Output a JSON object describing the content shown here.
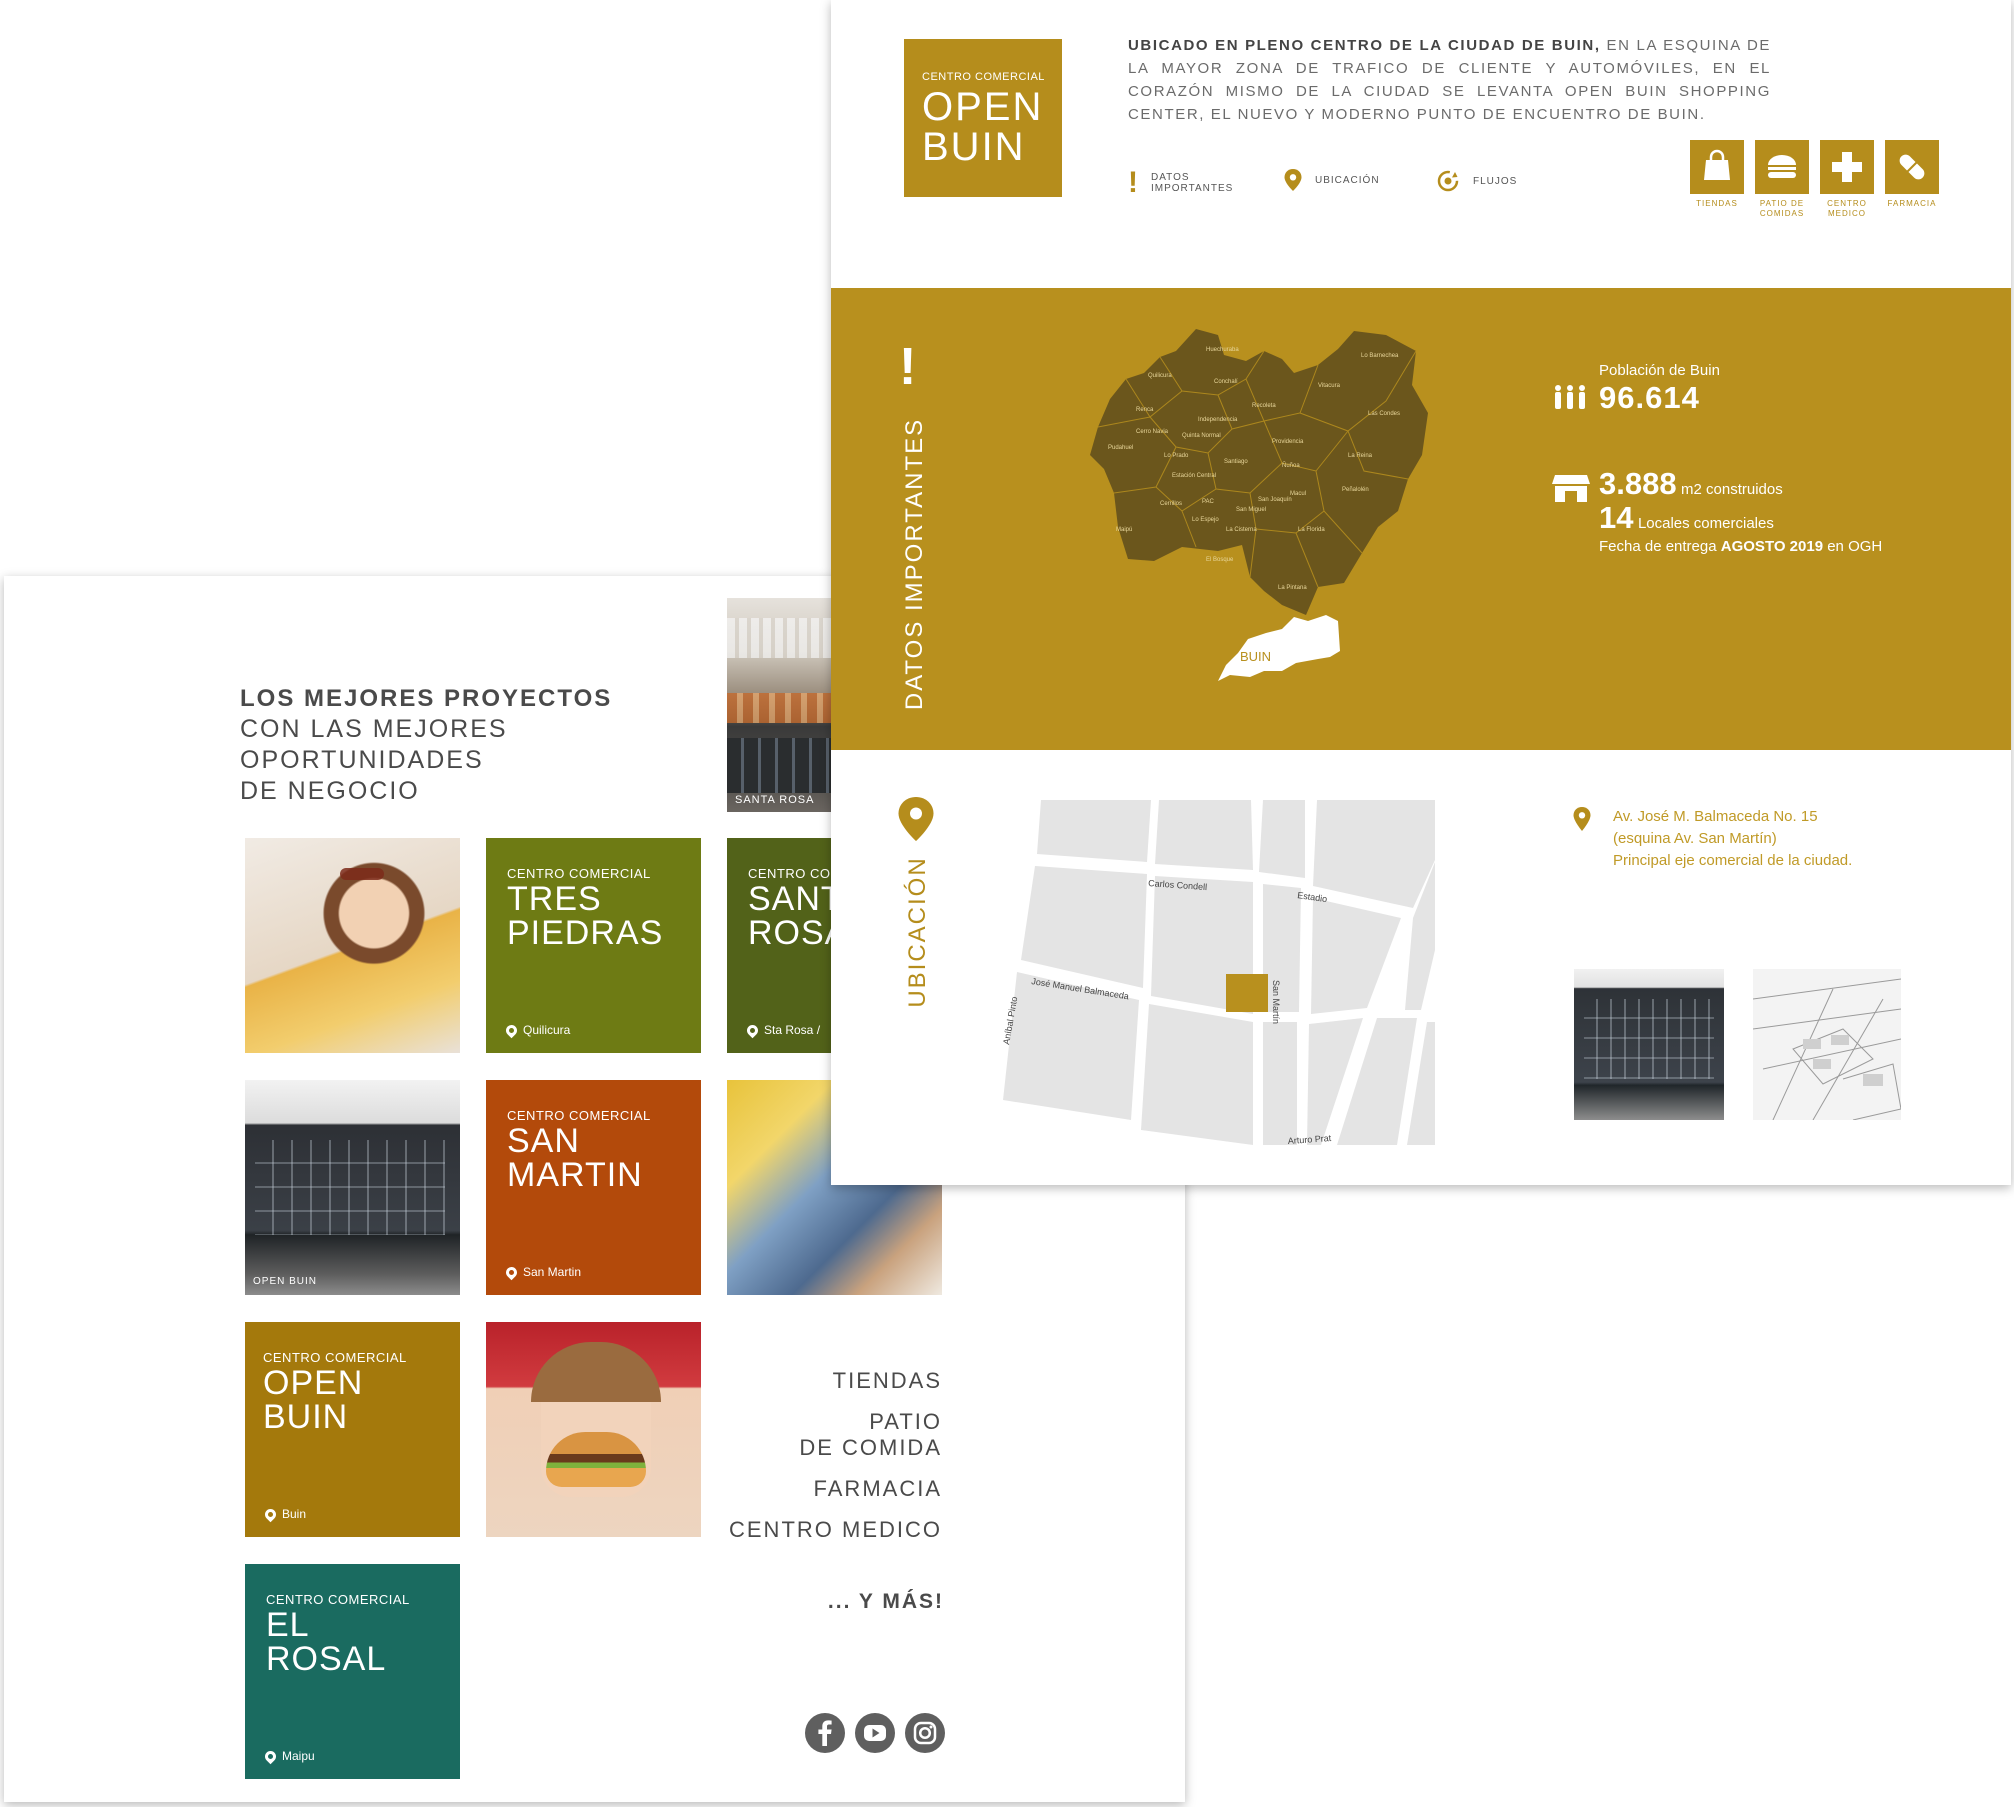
{
  "back_page": {
    "headline": {
      "bold": "LOS MEJORES PROYECTOS",
      "lines": [
        "CON LAS MEJORES",
        "OPORTUNIDADES",
        "DE NEGOCIO"
      ]
    },
    "top_photo_caption": "SANTA ROSA",
    "tiles": [
      {
        "kicker": "CENTRO COMERCIAL",
        "name_lines": [
          "TRES",
          "PIEDRAS"
        ],
        "place": "Quilicura",
        "color": "#6e7b14"
      },
      {
        "kicker": "CENTRO CO",
        "name_lines": [
          "SANT",
          "ROSA"
        ],
        "place": "Sta Rosa /",
        "color": "#526219"
      },
      {
        "kicker": "CENTRO COMERCIAL",
        "name_lines": [
          "SAN",
          "MARTIN"
        ],
        "place": "San Martin",
        "color": "#b34a0b"
      },
      {
        "kicker": "CENTRO COMERCIAL",
        "name_lines": [
          "OPEN",
          "BUIN"
        ],
        "place": "Buin",
        "color": "#a4790c"
      },
      {
        "kicker": "CENTRO COMERCIAL",
        "name_lines": [
          "EL",
          "ROSAL"
        ],
        "place": "Maipu",
        "color": "#1a6b60"
      }
    ],
    "building_caption": "OPEN BUIN",
    "menu": [
      "TIENDAS",
      "PATIO",
      "DE COMIDA",
      "FARMACIA",
      "CENTRO MEDICO"
    ],
    "more": "... Y MÁS!",
    "social_icons": [
      "facebook-icon",
      "youtube-icon",
      "instagram-icon"
    ]
  },
  "front_page": {
    "logo": {
      "kicker": "CENTRO COMERCIAL",
      "line1": "OPEN",
      "line2": "BUIN"
    },
    "intro_bold": "UBICADO EN PLENO CENTRO DE LA CIUDAD DE BUIN,",
    "intro_rest": " EN LA ESQUINA DE LA MAYOR ZONA DE TRAFICO DE CLIENTE Y AUTOMÓVILES, EN EL CORAZÓN MISMO DE LA CIUDAD SE LEVANTA OPEN BUIN SHOPPING CENTER, EL NUEVO Y MODERNO PUNTO DE ENCUENTRO DE BUIN.",
    "nav": {
      "datos_1": "DATOS",
      "datos_2": "IMPORTANTES",
      "ubicacion": "UBICACIÓN",
      "flujos": "FLUJOS"
    },
    "services": [
      {
        "icon": "shopping-bag-icon",
        "label_1": "TIENDAS",
        "label_2": ""
      },
      {
        "icon": "burger-icon",
        "label_1": "PATIO DE",
        "label_2": "COMIDAS"
      },
      {
        "icon": "medical-cross-icon",
        "label_1": "CENTRO",
        "label_2": "MEDICO"
      },
      {
        "icon": "pill-icon",
        "label_1": "FARMACIA",
        "label_2": ""
      }
    ],
    "datos": {
      "section_title": "DATOS IMPORTANTES",
      "map_label": "BUIN",
      "population_label": "Población de Buin",
      "population_value": "96.614",
      "m2_value": "3.888",
      "m2_label": "m2 construidos",
      "locales_value": "14",
      "locales_label": "Locales comerciales",
      "fecha_prefix": "Fecha de entrega",
      "fecha_bold": "AGOSTO 2019",
      "fecha_suffix": "en OGH",
      "communes": [
        "Lo Barnechea",
        "Huechuraba",
        "Quilicura",
        "Conchalí",
        "Vitacura",
        "Recoleta",
        "Renca",
        "Independencia",
        "Las Condes",
        "Cerro Navia",
        "Quinta Normal",
        "Providencia",
        "Pudahuel",
        "Lo Prado",
        "Santiago",
        "Ñuñoa",
        "La Reina",
        "Estación Central",
        "Macul",
        "Peñalolén",
        "Cerrillos",
        "PAC",
        "San Miguel",
        "San Joaquín",
        "Maipú",
        "Lo Espejo",
        "La Cisterna",
        "La Florida",
        "El Bosque",
        "La Pintana"
      ]
    },
    "ubicacion": {
      "section_title": "UBICACIÓN",
      "streets": {
        "carlos_condell": "Carlos Condell",
        "estadio": "Estadio",
        "balmaceda": "José Manuel Balmaceda",
        "san_martin": "San Martín",
        "anibal_pinto": "Aníbal Pinto",
        "arturo_prat": "Arturo Prat"
      },
      "address_1": "Av. José M. Balmaceda No. 15",
      "address_2": "(esquina Av. San Martín)",
      "address_3": "Principal eje comercial de la ciudad."
    }
  },
  "colors": {
    "gold": "#b8901e",
    "gold_text": "#c09a27",
    "grey_text": "#4a4a4a"
  }
}
